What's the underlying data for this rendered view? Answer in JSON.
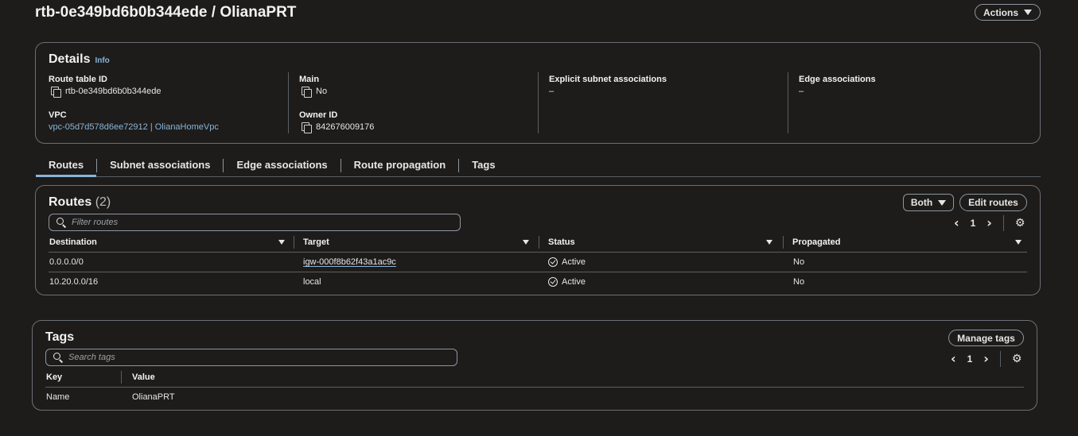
{
  "header": {
    "title": "rtb-0e349bd6b0b344ede / OlianaPRT",
    "actions_label": "Actions"
  },
  "details": {
    "title": "Details",
    "info_label": "Info",
    "route_table_id_label": "Route table ID",
    "route_table_id": "rtb-0e349bd6b0b344ede",
    "vpc_label": "VPC",
    "vpc_value": "vpc-05d7d578d6ee72912 | OlianaHomeVpc",
    "main_label": "Main",
    "main_value": "No",
    "owner_id_label": "Owner ID",
    "owner_id": "842676009176",
    "explicit_subnet_label": "Explicit subnet associations",
    "explicit_subnet_value": "–",
    "edge_assoc_label": "Edge associations",
    "edge_assoc_value": "–"
  },
  "tabs": [
    {
      "label": "Routes"
    },
    {
      "label": "Subnet associations"
    },
    {
      "label": "Edge associations"
    },
    {
      "label": "Route propagation"
    },
    {
      "label": "Tags"
    }
  ],
  "routes": {
    "title": "Routes",
    "count": "(2)",
    "filter_label": "Both",
    "edit_label": "Edit routes",
    "search_placeholder": "Filter routes",
    "page": "1",
    "columns": [
      "Destination",
      "Target",
      "Status",
      "Propagated"
    ],
    "rows": [
      {
        "destination": "0.0.0.0/0",
        "target": "igw-000f8b62f43a1ac9c",
        "status": "Active",
        "propagated": "No"
      },
      {
        "destination": "10.20.0.0/16",
        "target": "local",
        "status": "Active",
        "propagated": "No"
      }
    ]
  },
  "tags": {
    "title": "Tags",
    "manage_label": "Manage tags",
    "search_placeholder": "Search tags",
    "page": "1",
    "columns": [
      "Key",
      "Value"
    ],
    "rows": [
      {
        "key": "Name",
        "value": "OlianaPRT"
      }
    ]
  },
  "colors": {
    "background": "#1d1c1a",
    "link": "#89b4d9",
    "border": "#6b6f74"
  }
}
